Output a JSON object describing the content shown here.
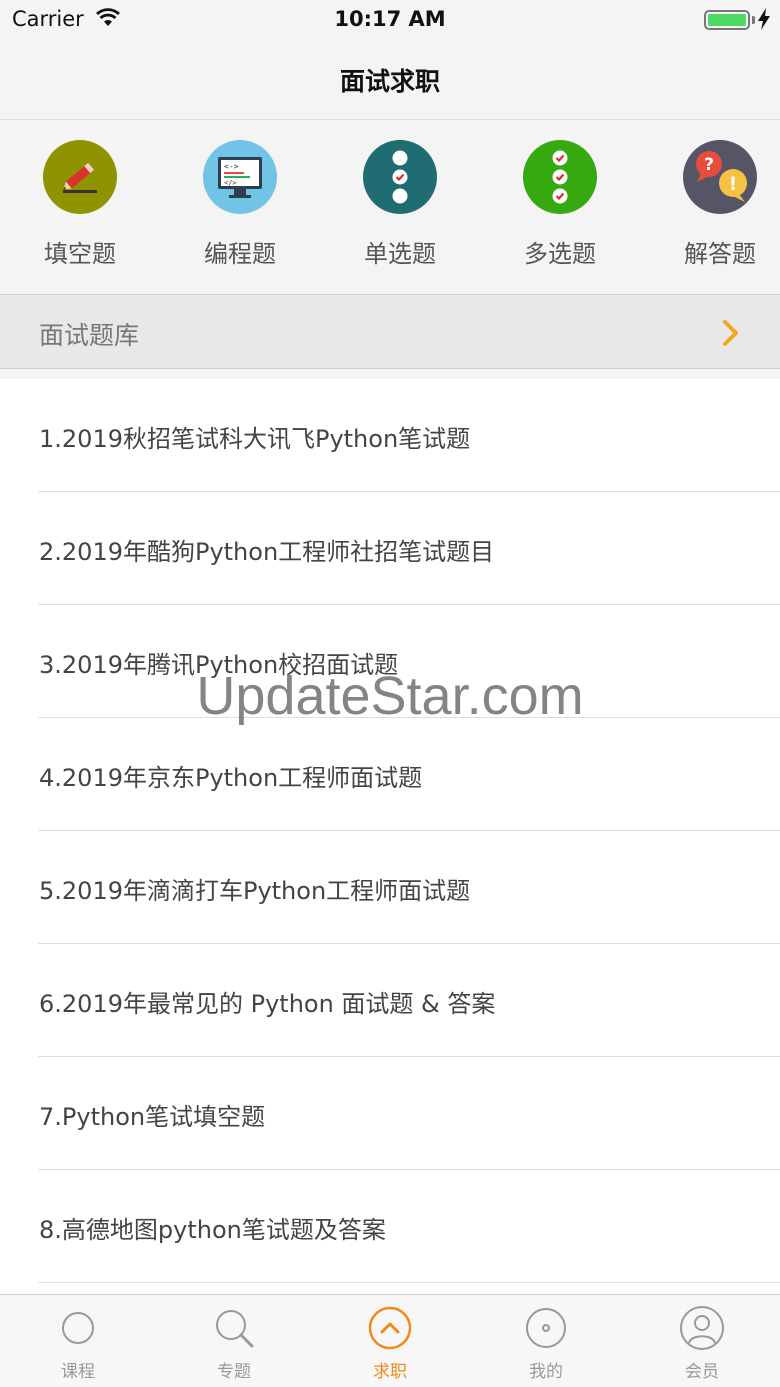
{
  "status_bar": {
    "carrier": "Carrier",
    "time": "10:17 AM"
  },
  "nav": {
    "title": "面试求职"
  },
  "categories": [
    {
      "label": "填空题",
      "icon": "pencil-icon",
      "color": "#8f9300"
    },
    {
      "label": "编程题",
      "icon": "code-monitor-icon",
      "color": "#71c4e6"
    },
    {
      "label": "单选题",
      "icon": "single-choice-icon",
      "color": "#1f6d72"
    },
    {
      "label": "多选题",
      "icon": "multi-choice-icon",
      "color": "#36a90f"
    },
    {
      "label": "解答题",
      "icon": "question-answer-icon",
      "color": "#555566"
    }
  ],
  "bank": {
    "label": "面试题库",
    "accent": "#f5a623"
  },
  "list": [
    "1.2019秋招笔试科大讯飞Python笔试题",
    "2.2019年酷狗Python工程师社招笔试题目",
    "3.2019年腾讯Python校招面试题",
    "4.2019年京东Python工程师面试题",
    "5.2019年滴滴打车Python工程师面试题",
    "6.2019年最常见的 Python 面试题 & 答案",
    "7.Python笔试填空题",
    "8.高德地图python笔试题及答案"
  ],
  "watermark": "UpdateStar.com",
  "tabs": [
    {
      "label": "课程",
      "icon": "circle-icon",
      "active": false
    },
    {
      "label": "专题",
      "icon": "search-icon",
      "active": false
    },
    {
      "label": "求职",
      "icon": "chevron-up-circle-icon",
      "active": true
    },
    {
      "label": "我的",
      "icon": "disc-icon",
      "active": false
    },
    {
      "label": "会员",
      "icon": "user-icon",
      "active": false
    }
  ],
  "colors": {
    "active_tab": "#f08a1c",
    "inactive_tab": "#999999"
  }
}
